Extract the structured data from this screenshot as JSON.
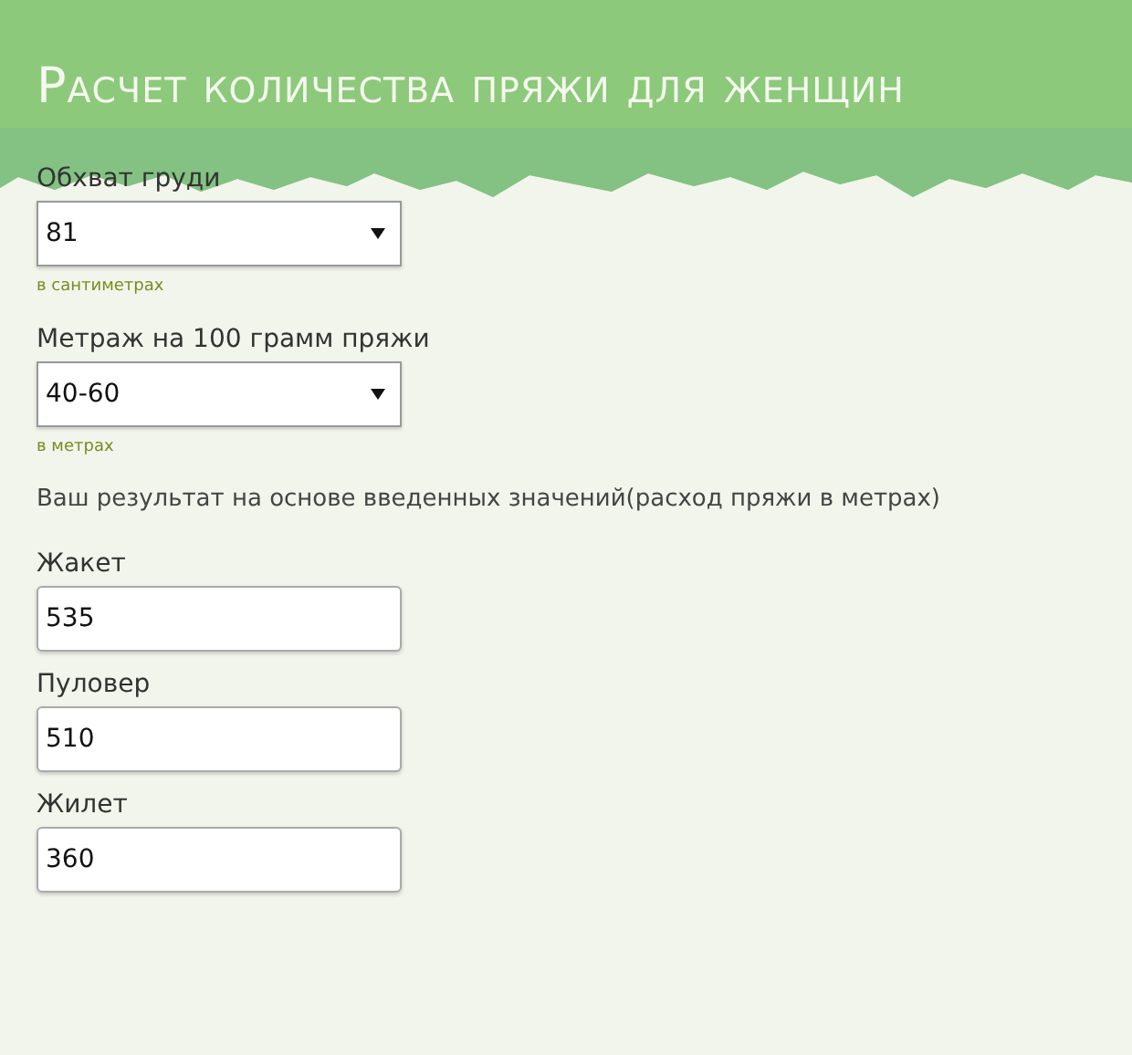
{
  "title": "Расчет количества пряжи для женщин",
  "inputs": [
    {
      "label": "Обхват груди",
      "value": "81",
      "hint": "в сантиметрах"
    },
    {
      "label": "Метраж на 100 грамм пряжи",
      "value": "40-60",
      "hint": "в метрах"
    }
  ],
  "result_text": "Ваш результат на основе введенных значений(расход пряжи в метрах)",
  "results": [
    {
      "label": "Жакет",
      "value": "535"
    },
    {
      "label": "Пуловер",
      "value": "510"
    },
    {
      "label": "Жилет",
      "value": "360"
    }
  ]
}
